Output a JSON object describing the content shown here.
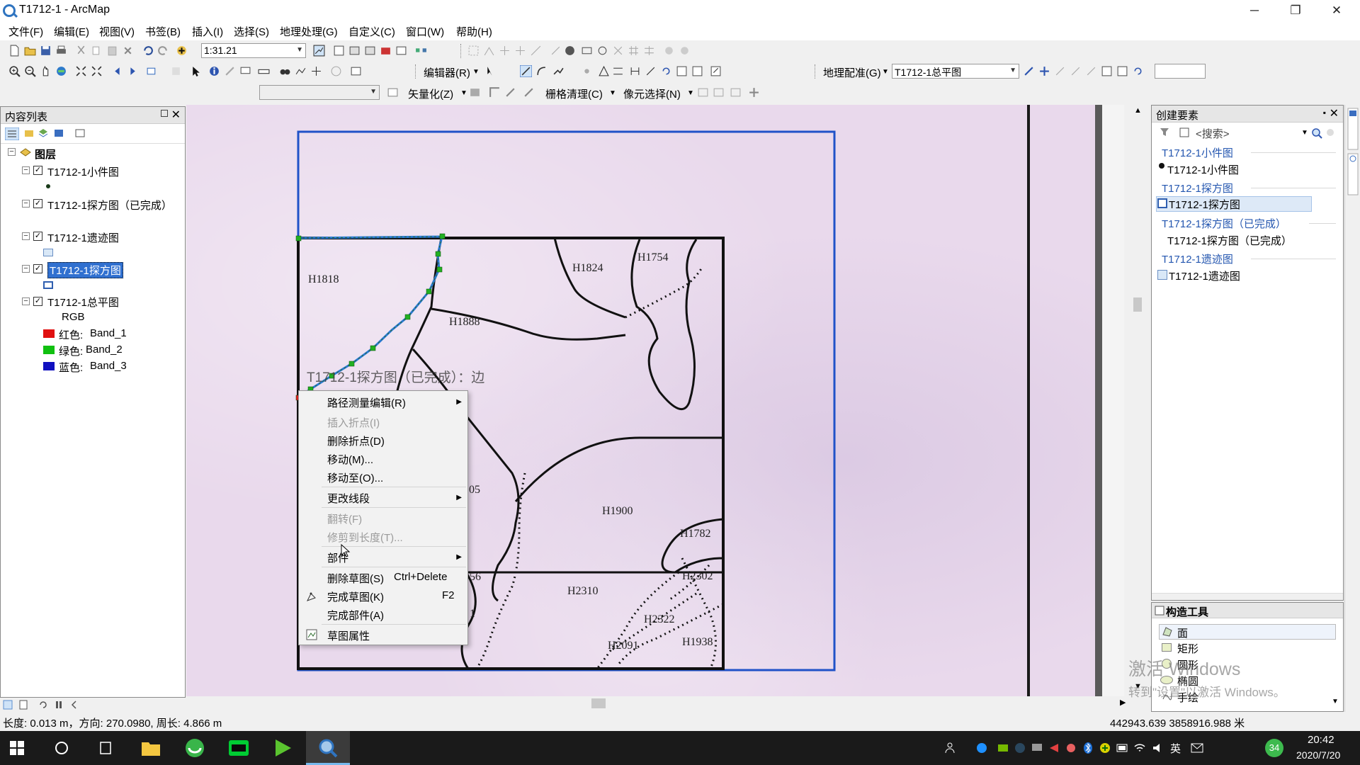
{
  "window": {
    "title": "T1712-1 - ArcMap",
    "minimize": "─",
    "restore": "❐",
    "close": "✕"
  },
  "menu": [
    "文件(F)",
    "编辑(E)",
    "视图(V)",
    "书签(B)",
    "插入(I)",
    "选择(S)",
    "地理处理(G)",
    "自定义(C)",
    "窗口(W)",
    "帮助(H)"
  ],
  "toolbar": {
    "scale": "1:31.21",
    "editor_label": "编辑器(R)",
    "georef_label": "地理配准(G)",
    "georef_layer": "T1712-1总平图",
    "vectorize_label": "矢量化(Z)",
    "raster_cleanup_label": "栅格清理(C)",
    "cell_select_label": "像元选择(N)"
  },
  "toc": {
    "title": "内容列表",
    "root": "图层",
    "layers": [
      {
        "name": "T1712-1小件图",
        "checked": true,
        "selected": false
      },
      {
        "name": "T1712-1探方图（已完成）",
        "checked": true,
        "selected": false
      },
      {
        "name": "T1712-1遗迹图",
        "checked": true,
        "selected": false
      },
      {
        "name": "T1712-1探方图",
        "checked": true,
        "selected": true
      },
      {
        "name": "T1712-1总平图",
        "checked": true,
        "selected": false
      }
    ],
    "raster": {
      "rgb": "RGB",
      "bands": [
        {
          "label": "红色:",
          "band": "Band_1",
          "color": "#e01010"
        },
        {
          "label": "绿色:",
          "band": "Band_2",
          "color": "#10c010"
        },
        {
          "label": "蓝色:",
          "band": "Band_3",
          "color": "#1010c0"
        }
      ]
    }
  },
  "map": {
    "labels": [
      "H1818",
      "H1824",
      "H1754",
      "H1888",
      "05",
      "H1900",
      "H1782",
      "H2302",
      "H2310",
      "H2322",
      "H2091",
      "H1938",
      "56",
      "1"
    ],
    "edge_label": "T1712-1探方图（已完成）：边"
  },
  "context_menu": {
    "items": [
      {
        "label": "路径测量编辑(R)",
        "disabled": false,
        "submenu": true
      },
      {
        "label": "插入折点(I)",
        "disabled": true
      },
      {
        "label": "删除折点(D)",
        "disabled": false
      },
      {
        "label": "移动(M)...",
        "disabled": false
      },
      {
        "label": "移动至(O)...",
        "disabled": false
      },
      {
        "label": "更改线段",
        "disabled": false,
        "submenu": true
      },
      {
        "label": "翻转(F)",
        "disabled": true
      },
      {
        "label": "修剪到长度(T)...",
        "disabled": true
      },
      {
        "label": "部件",
        "disabled": false,
        "submenu": true
      },
      {
        "label": "删除草图(S)",
        "disabled": false,
        "shortcut": "Ctrl+Delete"
      },
      {
        "label": "完成草图(K)",
        "disabled": false,
        "shortcut": "F2"
      },
      {
        "label": "完成部件(A)",
        "disabled": false
      },
      {
        "label": "草图属性",
        "disabled": false
      }
    ]
  },
  "create_features": {
    "title": "创建要素",
    "search_placeholder": "<搜索>",
    "groups": [
      {
        "group": "T1712-1小件图",
        "item": "T1712-1小件图"
      },
      {
        "group": "T1712-1探方图",
        "item": "T1712-1探方图"
      },
      {
        "group": "T1712-1探方图（已完成）",
        "item": "T1712-1探方图（已完成）"
      },
      {
        "group": "T1712-1遗迹图",
        "item": "T1712-1遗迹图"
      }
    ]
  },
  "construct_tools": {
    "title": "构造工具",
    "tools": [
      "面",
      "矩形",
      "圆形",
      "椭圆",
      "手绘"
    ]
  },
  "watermark": {
    "line1": "激活 Windows",
    "line2": "转到\"设置\"以激活 Windows。"
  },
  "status": {
    "left": "长度: 0.013 m，方向: 270.0980, 周长: 4.866 m",
    "coords": "442943.639  3858916.988 米"
  },
  "taskbar": {
    "time": "20:42",
    "date": "2020/7/20",
    "ime": "英",
    "notif": "34"
  }
}
